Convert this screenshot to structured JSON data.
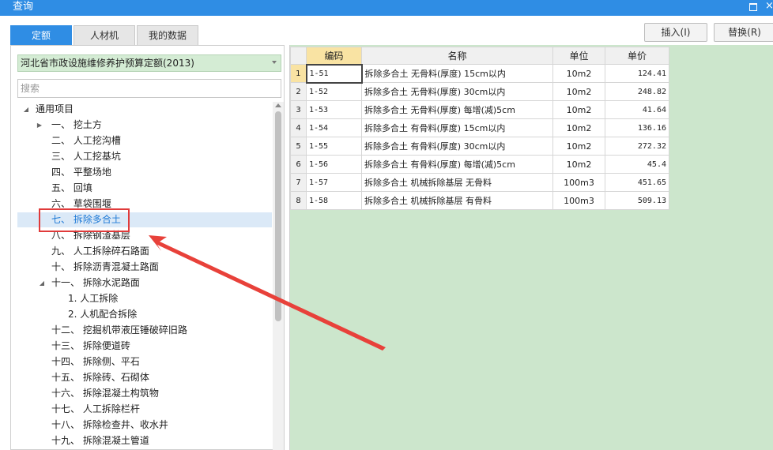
{
  "window": {
    "title": "查询",
    "maximize_icon": "maximize-icon",
    "close_icon": "close-icon",
    "close_glyph": "×"
  },
  "tabs": [
    {
      "label": "定额",
      "active": true
    },
    {
      "label": "人材机",
      "active": false
    },
    {
      "label": "我的数据",
      "active": false
    }
  ],
  "toolbar": {
    "insert_label": "插入(I)",
    "replace_label": "替换(R)"
  },
  "quota_selector": {
    "value": "河北省市政设施维修养护预算定额(2013)"
  },
  "search": {
    "placeholder": "搜索"
  },
  "tree": {
    "root": "通用项目",
    "items": [
      "一、 挖土方",
      "二、 人工挖沟槽",
      "三、 人工挖基坑",
      "四、 平整场地",
      "五、 回填",
      "六、 草袋围堰",
      "七、 拆除多合土",
      "八、 拆除钢渣基层",
      "九、 人工拆除碎石路面",
      "十、 拆除沥青混凝土路面",
      "十一、 拆除水泥路面",
      "1. 人工拆除",
      "2. 人机配合拆除",
      "十二、 挖掘机带液压锤破碎旧路",
      "十三、 拆除便道砖",
      "十四、 拆除侧、平石",
      "十五、 拆除砖、石砌体",
      "十六、 拆除混凝土构筑物",
      "十七、 人工拆除栏杆",
      "十八、 拆除检查井、收水井",
      "十九、 拆除混凝土管道"
    ]
  },
  "table": {
    "headers": {
      "code": "编码",
      "name": "名称",
      "unit": "单位",
      "price": "单价"
    },
    "rows": [
      {
        "n": "1",
        "code": "1-51",
        "name": "拆除多合土 无骨料(厚度) 15cm以内",
        "unit": "10m2",
        "price": "124.41"
      },
      {
        "n": "2",
        "code": "1-52",
        "name": "拆除多合土 无骨料(厚度) 30cm以内",
        "unit": "10m2",
        "price": "248.82"
      },
      {
        "n": "3",
        "code": "1-53",
        "name": "拆除多合土 无骨料(厚度) 每增(减)5cm",
        "unit": "10m2",
        "price": "41.64"
      },
      {
        "n": "4",
        "code": "1-54",
        "name": "拆除多合土 有骨料(厚度) 15cm以内",
        "unit": "10m2",
        "price": "136.16"
      },
      {
        "n": "5",
        "code": "1-55",
        "name": "拆除多合土 有骨料(厚度) 30cm以内",
        "unit": "10m2",
        "price": "272.32"
      },
      {
        "n": "6",
        "code": "1-56",
        "name": "拆除多合土 有骨料(厚度) 每增(减)5cm",
        "unit": "10m2",
        "price": "45.4"
      },
      {
        "n": "7",
        "code": "1-57",
        "name": "拆除多合土 机械拆除基层 无骨料",
        "unit": "100m3",
        "price": "451.65"
      },
      {
        "n": "8",
        "code": "1-58",
        "name": "拆除多合土 机械拆除基层 有骨料",
        "unit": "100m3",
        "price": "509.13"
      }
    ]
  },
  "colors": {
    "accent": "#2f8de4",
    "grid_background": "#cce6cc",
    "annotation": "#e03a3a"
  }
}
